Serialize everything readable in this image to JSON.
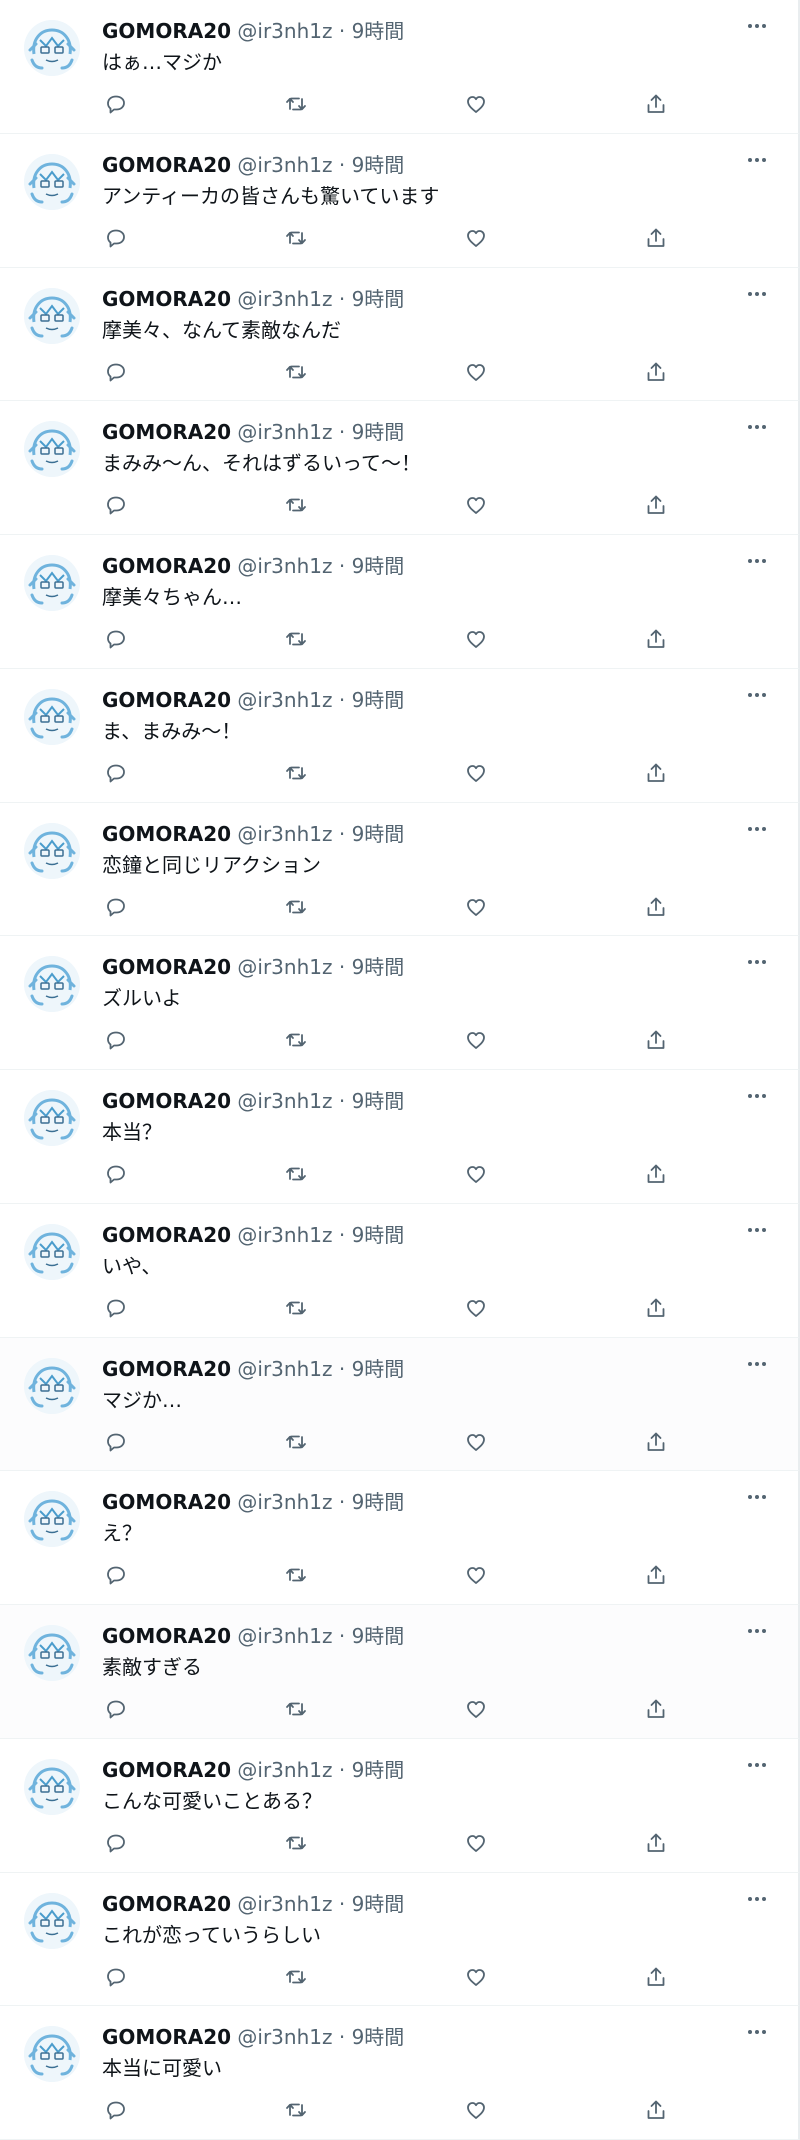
{
  "tweets": [
    {
      "display_name": "GOMORA20",
      "handle": "@ir3nh1z",
      "time": "9時間",
      "text": "はぁ…マジか"
    },
    {
      "display_name": "GOMORA20",
      "handle": "@ir3nh1z",
      "time": "9時間",
      "text": "アンティーカの皆さんも驚いています"
    },
    {
      "display_name": "GOMORA20",
      "handle": "@ir3nh1z",
      "time": "9時間",
      "text": "摩美々、なんて素敵なんだ"
    },
    {
      "display_name": "GOMORA20",
      "handle": "@ir3nh1z",
      "time": "9時間",
      "text": "まみみ〜ん、それはずるいって〜！"
    },
    {
      "display_name": "GOMORA20",
      "handle": "@ir3nh1z",
      "time": "9時間",
      "text": "摩美々ちゃん…"
    },
    {
      "display_name": "GOMORA20",
      "handle": "@ir3nh1z",
      "time": "9時間",
      "text": "ま、まみみ〜！"
    },
    {
      "display_name": "GOMORA20",
      "handle": "@ir3nh1z",
      "time": "9時間",
      "text": "恋鐘と同じリアクション"
    },
    {
      "display_name": "GOMORA20",
      "handle": "@ir3nh1z",
      "time": "9時間",
      "text": "ズルいよ"
    },
    {
      "display_name": "GOMORA20",
      "handle": "@ir3nh1z",
      "time": "9時間",
      "text": "本当？"
    },
    {
      "display_name": "GOMORA20",
      "handle": "@ir3nh1z",
      "time": "9時間",
      "text": "いや、"
    },
    {
      "display_name": "GOMORA20",
      "handle": "@ir3nh1z",
      "time": "9時間",
      "text": "マジか…"
    },
    {
      "display_name": "GOMORA20",
      "handle": "@ir3nh1z",
      "time": "9時間",
      "text": "え？"
    },
    {
      "display_name": "GOMORA20",
      "handle": "@ir3nh1z",
      "time": "9時間",
      "text": "素敵すぎる"
    },
    {
      "display_name": "GOMORA20",
      "handle": "@ir3nh1z",
      "time": "9時間",
      "text": "こんな可愛いことある？"
    },
    {
      "display_name": "GOMORA20",
      "handle": "@ir3nh1z",
      "time": "9時間",
      "text": "これが恋っていうらしい"
    },
    {
      "display_name": "GOMORA20",
      "handle": "@ir3nh1z",
      "time": "9時間",
      "text": "本当に可愛い"
    }
  ],
  "separator": "·",
  "icons": {
    "more": "more-horizontal-icon",
    "reply": "reply-icon",
    "retweet": "retweet-icon",
    "like": "heart-icon",
    "share": "share-icon"
  },
  "colors": {
    "text": "#0f1419",
    "secondary": "#536471",
    "avatar_accent": "#6fb3dd",
    "divider": "#eff3f4"
  }
}
